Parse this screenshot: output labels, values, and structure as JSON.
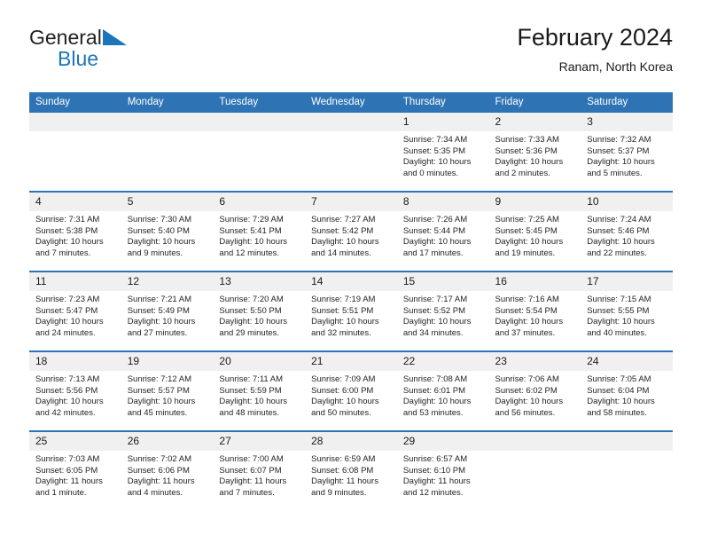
{
  "brand": {
    "line1": "General",
    "line2": "Blue",
    "triangle_color": "#1b75bb",
    "text_color": "#231f20"
  },
  "header": {
    "title": "February 2024",
    "subtitle": "Ranam, North Korea"
  },
  "colors": {
    "header_blue": "#2e74b5",
    "daynum_band": "#f0f0f0",
    "text": "#231f20"
  },
  "weekday_headers": [
    "Sunday",
    "Monday",
    "Tuesday",
    "Wednesday",
    "Thursday",
    "Friday",
    "Saturday"
  ],
  "weeks": [
    [
      {
        "day": "",
        "sunrise": "",
        "sunset": "",
        "daylight_hours": "",
        "daylight_minutes": ""
      },
      {
        "day": "",
        "sunrise": "",
        "sunset": "",
        "daylight_hours": "",
        "daylight_minutes": ""
      },
      {
        "day": "",
        "sunrise": "",
        "sunset": "",
        "daylight_hours": "",
        "daylight_minutes": ""
      },
      {
        "day": "",
        "sunrise": "",
        "sunset": "",
        "daylight_hours": "",
        "daylight_minutes": ""
      },
      {
        "day": "1",
        "sunrise": "Sunrise: 7:34 AM",
        "sunset": "Sunset: 5:35 PM",
        "daylight_hours": "Daylight: 10 hours",
        "daylight_minutes": "and 0 minutes."
      },
      {
        "day": "2",
        "sunrise": "Sunrise: 7:33 AM",
        "sunset": "Sunset: 5:36 PM",
        "daylight_hours": "Daylight: 10 hours",
        "daylight_minutes": "and 2 minutes."
      },
      {
        "day": "3",
        "sunrise": "Sunrise: 7:32 AM",
        "sunset": "Sunset: 5:37 PM",
        "daylight_hours": "Daylight: 10 hours",
        "daylight_minutes": "and 5 minutes."
      }
    ],
    [
      {
        "day": "4",
        "sunrise": "Sunrise: 7:31 AM",
        "sunset": "Sunset: 5:38 PM",
        "daylight_hours": "Daylight: 10 hours",
        "daylight_minutes": "and 7 minutes."
      },
      {
        "day": "5",
        "sunrise": "Sunrise: 7:30 AM",
        "sunset": "Sunset: 5:40 PM",
        "daylight_hours": "Daylight: 10 hours",
        "daylight_minutes": "and 9 minutes."
      },
      {
        "day": "6",
        "sunrise": "Sunrise: 7:29 AM",
        "sunset": "Sunset: 5:41 PM",
        "daylight_hours": "Daylight: 10 hours",
        "daylight_minutes": "and 12 minutes."
      },
      {
        "day": "7",
        "sunrise": "Sunrise: 7:27 AM",
        "sunset": "Sunset: 5:42 PM",
        "daylight_hours": "Daylight: 10 hours",
        "daylight_minutes": "and 14 minutes."
      },
      {
        "day": "8",
        "sunrise": "Sunrise: 7:26 AM",
        "sunset": "Sunset: 5:44 PM",
        "daylight_hours": "Daylight: 10 hours",
        "daylight_minutes": "and 17 minutes."
      },
      {
        "day": "9",
        "sunrise": "Sunrise: 7:25 AM",
        "sunset": "Sunset: 5:45 PM",
        "daylight_hours": "Daylight: 10 hours",
        "daylight_minutes": "and 19 minutes."
      },
      {
        "day": "10",
        "sunrise": "Sunrise: 7:24 AM",
        "sunset": "Sunset: 5:46 PM",
        "daylight_hours": "Daylight: 10 hours",
        "daylight_minutes": "and 22 minutes."
      }
    ],
    [
      {
        "day": "11",
        "sunrise": "Sunrise: 7:23 AM",
        "sunset": "Sunset: 5:47 PM",
        "daylight_hours": "Daylight: 10 hours",
        "daylight_minutes": "and 24 minutes."
      },
      {
        "day": "12",
        "sunrise": "Sunrise: 7:21 AM",
        "sunset": "Sunset: 5:49 PM",
        "daylight_hours": "Daylight: 10 hours",
        "daylight_minutes": "and 27 minutes."
      },
      {
        "day": "13",
        "sunrise": "Sunrise: 7:20 AM",
        "sunset": "Sunset: 5:50 PM",
        "daylight_hours": "Daylight: 10 hours",
        "daylight_minutes": "and 29 minutes."
      },
      {
        "day": "14",
        "sunrise": "Sunrise: 7:19 AM",
        "sunset": "Sunset: 5:51 PM",
        "daylight_hours": "Daylight: 10 hours",
        "daylight_minutes": "and 32 minutes."
      },
      {
        "day": "15",
        "sunrise": "Sunrise: 7:17 AM",
        "sunset": "Sunset: 5:52 PM",
        "daylight_hours": "Daylight: 10 hours",
        "daylight_minutes": "and 34 minutes."
      },
      {
        "day": "16",
        "sunrise": "Sunrise: 7:16 AM",
        "sunset": "Sunset: 5:54 PM",
        "daylight_hours": "Daylight: 10 hours",
        "daylight_minutes": "and 37 minutes."
      },
      {
        "day": "17",
        "sunrise": "Sunrise: 7:15 AM",
        "sunset": "Sunset: 5:55 PM",
        "daylight_hours": "Daylight: 10 hours",
        "daylight_minutes": "and 40 minutes."
      }
    ],
    [
      {
        "day": "18",
        "sunrise": "Sunrise: 7:13 AM",
        "sunset": "Sunset: 5:56 PM",
        "daylight_hours": "Daylight: 10 hours",
        "daylight_minutes": "and 42 minutes."
      },
      {
        "day": "19",
        "sunrise": "Sunrise: 7:12 AM",
        "sunset": "Sunset: 5:57 PM",
        "daylight_hours": "Daylight: 10 hours",
        "daylight_minutes": "and 45 minutes."
      },
      {
        "day": "20",
        "sunrise": "Sunrise: 7:11 AM",
        "sunset": "Sunset: 5:59 PM",
        "daylight_hours": "Daylight: 10 hours",
        "daylight_minutes": "and 48 minutes."
      },
      {
        "day": "21",
        "sunrise": "Sunrise: 7:09 AM",
        "sunset": "Sunset: 6:00 PM",
        "daylight_hours": "Daylight: 10 hours",
        "daylight_minutes": "and 50 minutes."
      },
      {
        "day": "22",
        "sunrise": "Sunrise: 7:08 AM",
        "sunset": "Sunset: 6:01 PM",
        "daylight_hours": "Daylight: 10 hours",
        "daylight_minutes": "and 53 minutes."
      },
      {
        "day": "23",
        "sunrise": "Sunrise: 7:06 AM",
        "sunset": "Sunset: 6:02 PM",
        "daylight_hours": "Daylight: 10 hours",
        "daylight_minutes": "and 56 minutes."
      },
      {
        "day": "24",
        "sunrise": "Sunrise: 7:05 AM",
        "sunset": "Sunset: 6:04 PM",
        "daylight_hours": "Daylight: 10 hours",
        "daylight_minutes": "and 58 minutes."
      }
    ],
    [
      {
        "day": "25",
        "sunrise": "Sunrise: 7:03 AM",
        "sunset": "Sunset: 6:05 PM",
        "daylight_hours": "Daylight: 11 hours",
        "daylight_minutes": "and 1 minute."
      },
      {
        "day": "26",
        "sunrise": "Sunrise: 7:02 AM",
        "sunset": "Sunset: 6:06 PM",
        "daylight_hours": "Daylight: 11 hours",
        "daylight_minutes": "and 4 minutes."
      },
      {
        "day": "27",
        "sunrise": "Sunrise: 7:00 AM",
        "sunset": "Sunset: 6:07 PM",
        "daylight_hours": "Daylight: 11 hours",
        "daylight_minutes": "and 7 minutes."
      },
      {
        "day": "28",
        "sunrise": "Sunrise: 6:59 AM",
        "sunset": "Sunset: 6:08 PM",
        "daylight_hours": "Daylight: 11 hours",
        "daylight_minutes": "and 9 minutes."
      },
      {
        "day": "29",
        "sunrise": "Sunrise: 6:57 AM",
        "sunset": "Sunset: 6:10 PM",
        "daylight_hours": "Daylight: 11 hours",
        "daylight_minutes": "and 12 minutes."
      },
      {
        "day": "",
        "sunrise": "",
        "sunset": "",
        "daylight_hours": "",
        "daylight_minutes": ""
      },
      {
        "day": "",
        "sunrise": "",
        "sunset": "",
        "daylight_hours": "",
        "daylight_minutes": ""
      }
    ]
  ]
}
